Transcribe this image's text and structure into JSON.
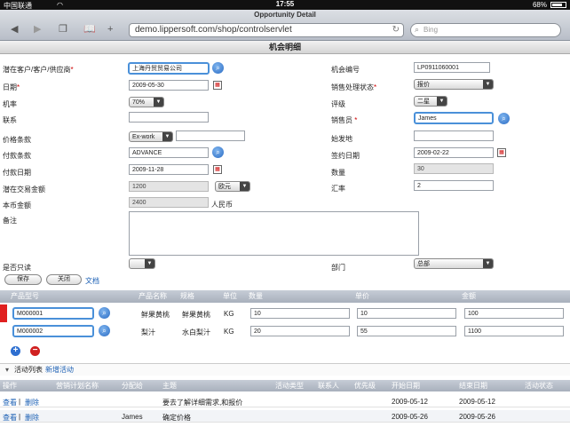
{
  "status": {
    "carrier": "中国联通",
    "wifi": "wifi",
    "time": "17:55",
    "battery": "68%"
  },
  "browser": {
    "title": "Opportunity Detail",
    "url": "demo.lippersoft.com/shop/controlservlet",
    "search_placeholder": "Bing"
  },
  "panel": {
    "title": "机会明细"
  },
  "form": {
    "customer_label": "潜在客户/客户/供应商",
    "customer_value": "上海丹贸贸易公司",
    "date_label": "日期",
    "date_value": "2009-05-30",
    "probability_label": "机率",
    "probability_value": "70%",
    "contact_label": "联系",
    "contact_value": "",
    "price_terms_label": "价格条款",
    "price_terms_value": "Ex-work",
    "payment_terms_label": "付款条款",
    "payment_terms_value": "ADVANCE",
    "pay_date_label": "付款日期",
    "pay_date_value": "2009-11-28",
    "deal_amount_label": "潜在交易金额",
    "deal_amount_value": "1200",
    "currency_value": "欧元",
    "local_amount_label": "本币金额",
    "local_amount_value": "2400",
    "local_currency": "人民币",
    "remark_label": "备注",
    "shipped_label": "是否只读",
    "shipped_value": "",
    "opp_no_label": "机会编号",
    "opp_no_value": "LP0911060001",
    "sales_state_label": "销售处理状态",
    "sales_state_value": "报价",
    "rating_label": "评级",
    "rating_value": "二星",
    "salesman_label": "销售员",
    "salesman_value": "James",
    "origin_label": "始发地",
    "origin_value": "",
    "sign_date_label": "签约日期",
    "sign_date_value": "2009-02-22",
    "quantity_label": "数量",
    "quantity_value": "30",
    "rate_label": "汇率",
    "rate_value": "2",
    "dept_label": "部门",
    "dept_value": "总部"
  },
  "buttons": {
    "save": "保存",
    "close": "关闭",
    "doc": "文档"
  },
  "products": {
    "headers": [
      "产品型号",
      "产品名称",
      "规格",
      "单位",
      "数量",
      "单价",
      "金额"
    ],
    "rows": [
      {
        "model": "M000001",
        "name": "鲜果黄桃",
        "spec": "鲜果黄桃",
        "unit": "KG",
        "qty": "10",
        "price": "10",
        "amount": "100"
      },
      {
        "model": "M000002",
        "name": "梨汁",
        "spec": "水白梨汁",
        "unit": "KG",
        "qty": "20",
        "price": "55",
        "amount": "1100"
      }
    ],
    "add_icon": "plus-circle-icon",
    "remove_icon": "minus-circle-icon"
  },
  "activities": {
    "title": "活动列表",
    "new_link": "新增活动",
    "headers": [
      "操作",
      "营销计划名称",
      "分配给",
      "主题",
      "活动类型",
      "联系人",
      "优先级",
      "开始日期",
      "结束日期",
      "活动状态"
    ],
    "rows": [
      {
        "view": "查看",
        "delete": "删除",
        "plan": "",
        "assign": "",
        "subject": "要去了解详细需求,和报价",
        "type": "",
        "contact": "",
        "priority": "",
        "start": "2009-05-12",
        "end": "2009-05-12",
        "state": ""
      },
      {
        "view": "查看",
        "delete": "删除",
        "plan": "",
        "assign": "James",
        "subject": "确定价格",
        "type": "",
        "contact": "",
        "priority": "",
        "start": "2009-05-26",
        "end": "2009-05-26",
        "state": ""
      }
    ]
  },
  "colors": {
    "accent": "#4a90d9",
    "required": "#cc0000",
    "row_marker": "#e02020"
  }
}
